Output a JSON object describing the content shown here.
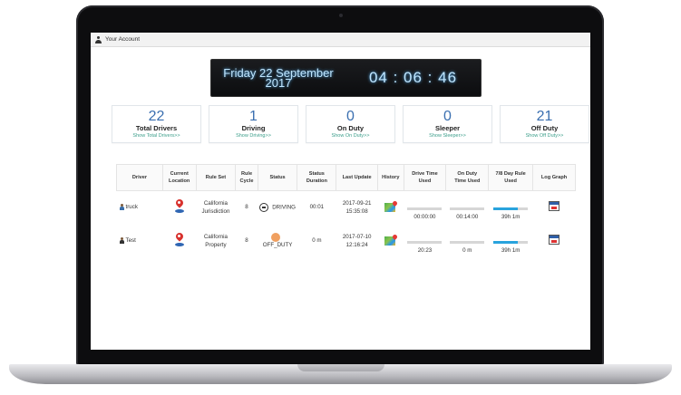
{
  "header": {
    "account_label": "Your Account"
  },
  "clock": {
    "date_line1": "Friday 22 September",
    "date_line2": "2017",
    "time": "04 : 06 : 46"
  },
  "stats": [
    {
      "count": "22",
      "label": "Total Drivers",
      "link": "Show Total Drivers>>"
    },
    {
      "count": "1",
      "label": "Driving",
      "link": "Show Driving>>"
    },
    {
      "count": "0",
      "label": "On Duty",
      "link": "Show On Duty>>"
    },
    {
      "count": "0",
      "label": "Sleeper",
      "link": "Show Sleeper>>"
    },
    {
      "count": "21",
      "label": "Off Duty",
      "link": "Show Off Duty>>"
    }
  ],
  "table": {
    "headers": {
      "driver": "Driver",
      "location_1": "Current",
      "location_2": "Location",
      "rule_set": "Rule Set",
      "rule_cycle_1": "Rule",
      "rule_cycle_2": "Cycle",
      "status": "Status",
      "duration_1": "Status",
      "duration_2": "Duration",
      "last_update": "Last Update",
      "history": "History",
      "drive_time_1": "Drive Time",
      "drive_time_2": "Used",
      "on_duty_1": "On Duty",
      "on_duty_2": "Time Used",
      "rule_day_1": "7/8 Day Rule",
      "rule_day_2": "Used",
      "log_graph": "Log Graph"
    },
    "rows": [
      {
        "driver": "truck",
        "rule_set_1": "California",
        "rule_set_2": "Jurisdiction",
        "rule_cycle": "8",
        "status": "DRIVING",
        "status_duration": "00:01",
        "last_update_date": "2017-09-21",
        "last_update_time": "15:35:08",
        "drive_time_used": "00:00:00",
        "on_duty_time_used": "00:14:00",
        "day_rule_used": "39h 1m",
        "day_rule_fraction": 0.7
      },
      {
        "driver": "Test",
        "rule_set_1": "California",
        "rule_set_2": "Property",
        "rule_cycle": "8",
        "status": "OFF_DUTY",
        "status_duration": "0 m",
        "last_update_date": "2017-07-10",
        "last_update_time": "12:16:24",
        "drive_time_used": "20:23",
        "on_duty_time_used": "0 m",
        "day_rule_used": "39h 1m",
        "day_rule_fraction": 0.7
      }
    ]
  },
  "colors": {
    "accent_blue": "#3a6fb0",
    "link_teal": "#3b9e8a",
    "progress_blue": "#29a3dd"
  }
}
